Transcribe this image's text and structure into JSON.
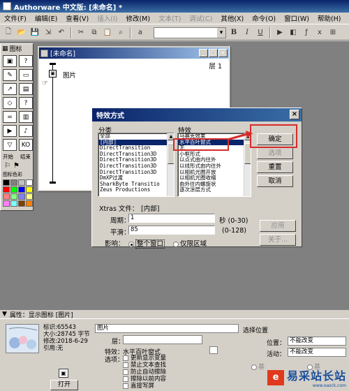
{
  "app": {
    "title": "Authorware 中文版: [未命名] *"
  },
  "menu": [
    {
      "label": "文件(F)",
      "disabled": false
    },
    {
      "label": "编辑(E)",
      "disabled": false
    },
    {
      "label": "查看(V)",
      "disabled": false
    },
    {
      "label": "插入(I)",
      "disabled": true
    },
    {
      "label": "修改(M)",
      "disabled": false
    },
    {
      "label": "文本(T)",
      "disabled": true
    },
    {
      "label": "调试(C)",
      "disabled": true
    },
    {
      "label": "其他(X)",
      "disabled": false
    },
    {
      "label": "命令(O)",
      "disabled": false
    },
    {
      "label": "窗口(W)",
      "disabled": false
    },
    {
      "label": "帮助(H)",
      "disabled": false
    }
  ],
  "toolbar": {
    "bold": "B",
    "italic": "I",
    "underline": "U"
  },
  "palette": {
    "title": "图标",
    "start_label": "开始",
    "end_label": "结束",
    "color_label": "图标色彩",
    "colors": [
      "#000000",
      "#808080",
      "#c0c0c0",
      "#ffffff",
      "#ff0000",
      "#00ff00",
      "#0000ff",
      "#ffff00",
      "#ff8080",
      "#80ff80",
      "#8080ff",
      "#ffff80",
      "#ff80ff",
      "#80ffff",
      "#804000",
      "#ff8000"
    ]
  },
  "flow_window": {
    "title": "[未命名]",
    "layer_label": "层 1",
    "node_label": "图片"
  },
  "dialog": {
    "title": "特效方式",
    "category_label": "分类",
    "effect_label": "特效",
    "categories": [
      "全部",
      "[内部]",
      "DirectTransition",
      "DirectTransition3D",
      "DirectTransition3D",
      "DirectTransition3D",
      "DirectTransition3D",
      "DmXP过渡",
      "SharkByte Transitio",
      "Zeus Productions"
    ],
    "selected_category": 1,
    "effects": [
      "马赛克效果",
      "水平百叶窗式",
      "无",
      "小框形式",
      "以点式由内往外",
      "以线形式由内往外",
      "以相机光圈开放",
      "以相机光圈收缩",
      "由外往内螺旋状",
      "逐次涂层方式"
    ],
    "selected_effect": 1,
    "xtras_label": "Xtras 文件：",
    "xtras_value": "[内部]",
    "period_label": "周期：",
    "period_value": "1",
    "period_unit": "秒 (0-30)",
    "smooth_label": "平滑：",
    "smooth_value": "85",
    "smooth_range": "(0-128)",
    "affect_label": "影响：",
    "affect_whole": "整个窗口",
    "affect_area": "仅限区域",
    "ok_button": "确定",
    "options_button": "选项",
    "reset_button": "重置",
    "cancel_button": "取消",
    "apply_button": "应用",
    "about_button": "关于..."
  },
  "props": {
    "title": "属性：显示图标 [图片]",
    "id": "标识:65543",
    "size": "大小:28745 字节",
    "modified": "修改:2018-6-29",
    "ref": "引用:无",
    "name_value": "图片",
    "layer_label": "层：",
    "effect_label": "特效：",
    "effect_value": "水平百叶窗式",
    "options_label": "选项：",
    "options": [
      "更新显示变量",
      "禁止文本查找",
      "防止自动擦除",
      "擦除以前内容",
      "直接写屏"
    ],
    "open_button": "打开",
    "select_pos_label": "选择位置",
    "position_label": "位置：",
    "position_value": "不能改变",
    "active_label": "活动：",
    "active_value": "不能改变",
    "radio_1": "基",
    "radio_2": "基"
  },
  "watermark": {
    "text": "易采站长站",
    "url": "www.easck.com"
  }
}
